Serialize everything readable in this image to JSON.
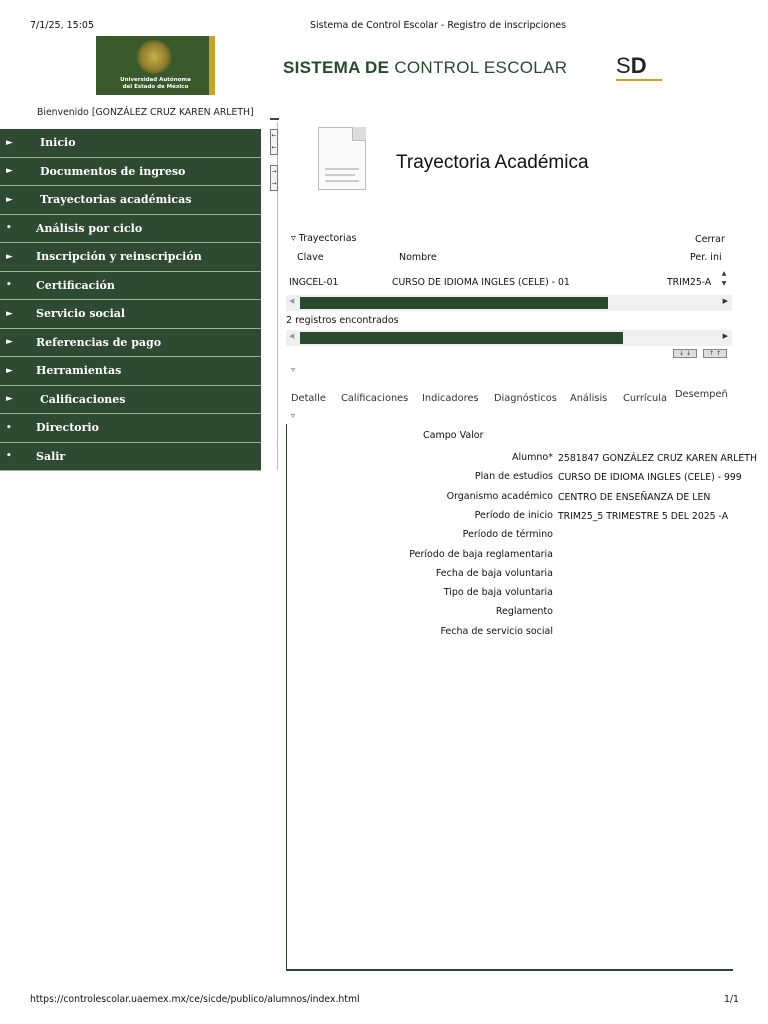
{
  "print_header": {
    "datetime": "7/1/25, 15:05",
    "title": "Sistema de Control Escolar - Registro de inscripciones"
  },
  "header": {
    "university_line1": "Universidad Autónoma",
    "university_line2": "del Estado de México",
    "system_title_bold": "SISTEMA DE",
    "system_title_rest": "CONTROL ESCOLAR",
    "sd_logo_s": "S",
    "sd_logo_d": "D",
    "welcome": "Bienvenido [GONZÁLEZ CRUZ KAREN ARLETH]"
  },
  "menu": [
    {
      "bullet": "►",
      "label": "Inicio",
      "sub": true
    },
    {
      "bullet": "►",
      "label": "Documentos de ingreso",
      "sub": true
    },
    {
      "bullet": "►",
      "label": "Trayectorias académicas",
      "sub": true
    },
    {
      "bullet": "•",
      "label": "Análisis por ciclo",
      "sub": false
    },
    {
      "bullet": "►",
      "label": "Inscripción y reinscripción",
      "sub": false
    },
    {
      "bullet": "•",
      "label": "Certificación",
      "sub": false
    },
    {
      "bullet": "►",
      "label": "Servicio social",
      "sub": false
    },
    {
      "bullet": "►",
      "label": "Referencias de pago",
      "sub": false
    },
    {
      "bullet": "►",
      "label": "Herramientas",
      "sub": false
    },
    {
      "bullet": "►",
      "label": "Calificaciones",
      "sub": true
    },
    {
      "bullet": "•",
      "label": "Directorio",
      "sub": false
    },
    {
      "bullet": "•",
      "label": "Salir",
      "sub": false
    }
  ],
  "splitter": {
    "collapse": "← ←",
    "expand": "→ →"
  },
  "page": {
    "title": "Trayectoria Académica"
  },
  "trajectories": {
    "header": "▿ Trayectorias",
    "close": "Cerrar",
    "columns": {
      "clave": "Clave",
      "nombre": "Nombre",
      "per_ini": "Per. ini"
    },
    "rows": [
      {
        "clave": "INGCEL-01",
        "nombre": "CURSO DE IDIOMA INGLES (CELE) - 01",
        "per_ini": "TRIM25-A"
      }
    ],
    "records_found": "2 registros encontrados",
    "sort_down": "↓ ↓",
    "sort_up": "↑ ↑"
  },
  "tabs": [
    "Detalle",
    "Calificaciones",
    "Indicadores",
    "Diagnósticos",
    "Análisis",
    "Currícula",
    "Desempeñ"
  ],
  "detail": {
    "header": "Campo Valor",
    "fields": [
      {
        "label": "Alumno*",
        "value": "2581847 GONZÁLEZ CRUZ KAREN ARLETH"
      },
      {
        "label": "Plan de estudios",
        "value": "CURSO DE IDIOMA INGLES (CELE) - 999"
      },
      {
        "label": "Organismo académico",
        "value": "CENTRO DE ENSEÑANZA DE LEN"
      },
      {
        "label": "Período de inicio",
        "value": "TRIM25_5 TRIMESTRE 5 DEL 2025 -A"
      },
      {
        "label": "Período de término",
        "value": ""
      },
      {
        "label": "Período de baja reglamentaria",
        "value": ""
      },
      {
        "label": "Fecha de baja voluntaria",
        "value": ""
      },
      {
        "label": "Tipo de baja voluntaria",
        "value": ""
      },
      {
        "label": "Reglamento",
        "value": ""
      },
      {
        "label": "Fecha de servicio social",
        "value": ""
      }
    ]
  },
  "footer": {
    "url": "https://controlescolar.uaemex.mx/ce/sicde/publico/alumnos/index.html",
    "page": "1/1"
  },
  "colors": {
    "menu_bg": "#2f4a32",
    "brand_green": "#264a2e",
    "accent_gold": "#c9a227"
  }
}
